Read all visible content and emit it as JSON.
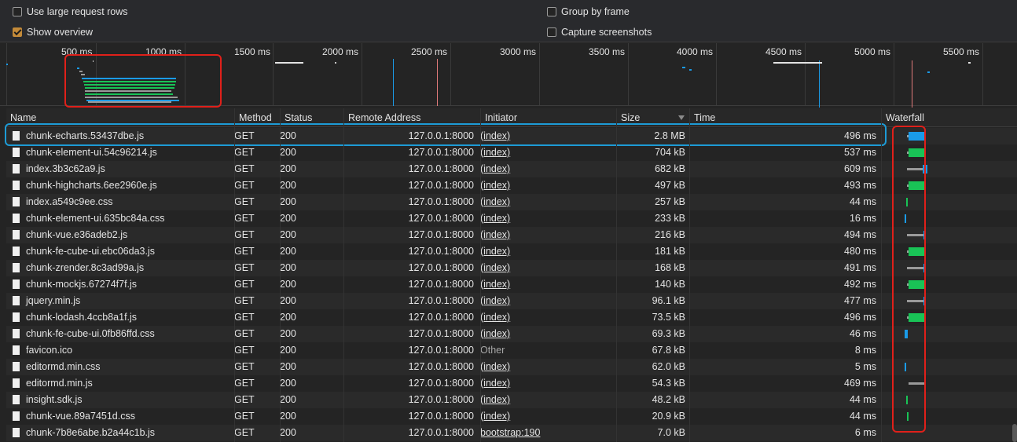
{
  "settings": {
    "large_rows": "Use large request rows",
    "show_overview": "Show overview",
    "group_by_frame": "Group by frame",
    "capture_screenshots": "Capture screenshots"
  },
  "overview": {
    "ticks": [
      "500 ms",
      "1000 ms",
      "1500 ms",
      "2000 ms",
      "2500 ms",
      "3000 ms",
      "3500 ms",
      "4000 ms",
      "4500 ms",
      "5000 ms",
      "5500 ms"
    ]
  },
  "columns": {
    "name": "Name",
    "method": "Method",
    "status": "Status",
    "remote": "Remote Address",
    "initiator": "Initiator",
    "size": "Size",
    "time": "Time",
    "waterfall": "Waterfall"
  },
  "colors": {
    "blue": "#1a9be8",
    "green": "#19c356",
    "gray": "#9a9a9a",
    "highlight_red": "#e0201a",
    "highlight_blue": "#1d9bd6"
  },
  "rows": [
    {
      "name": "chunk-echarts.53437dbe.js",
      "method": "GET",
      "status": "200",
      "remote": "127.0.0.1:8000",
      "initiator": "(index)",
      "size": "2.8 MB",
      "time": "496 ms"
    },
    {
      "name": "chunk-element-ui.54c96214.js",
      "method": "GET",
      "status": "200",
      "remote": "127.0.0.1:8000",
      "initiator": "(index)",
      "size": "704 kB",
      "time": "537 ms"
    },
    {
      "name": "index.3b3c62a9.js",
      "method": "GET",
      "status": "200",
      "remote": "127.0.0.1:8000",
      "initiator": "(index)",
      "size": "682 kB",
      "time": "609 ms"
    },
    {
      "name": "chunk-highcharts.6ee2960e.js",
      "method": "GET",
      "status": "200",
      "remote": "127.0.0.1:8000",
      "initiator": "(index)",
      "size": "497 kB",
      "time": "493 ms"
    },
    {
      "name": "index.a549c9ee.css",
      "method": "GET",
      "status": "200",
      "remote": "127.0.0.1:8000",
      "initiator": "(index)",
      "size": "257 kB",
      "time": "44 ms"
    },
    {
      "name": "chunk-element-ui.635bc84a.css",
      "method": "GET",
      "status": "200",
      "remote": "127.0.0.1:8000",
      "initiator": "(index)",
      "size": "233 kB",
      "time": "16 ms"
    },
    {
      "name": "chunk-vue.e36adeb2.js",
      "method": "GET",
      "status": "200",
      "remote": "127.0.0.1:8000",
      "initiator": "(index)",
      "size": "216 kB",
      "time": "494 ms"
    },
    {
      "name": "chunk-fe-cube-ui.ebc06da3.js",
      "method": "GET",
      "status": "200",
      "remote": "127.0.0.1:8000",
      "initiator": "(index)",
      "size": "181 kB",
      "time": "480 ms"
    },
    {
      "name": "chunk-zrender.8c3ad99a.js",
      "method": "GET",
      "status": "200",
      "remote": "127.0.0.1:8000",
      "initiator": "(index)",
      "size": "168 kB",
      "time": "491 ms"
    },
    {
      "name": "chunk-mockjs.67274f7f.js",
      "method": "GET",
      "status": "200",
      "remote": "127.0.0.1:8000",
      "initiator": "(index)",
      "size": "140 kB",
      "time": "492 ms"
    },
    {
      "name": "jquery.min.js",
      "method": "GET",
      "status": "200",
      "remote": "127.0.0.1:8000",
      "initiator": "(index)",
      "size": "96.1 kB",
      "time": "477 ms"
    },
    {
      "name": "chunk-lodash.4ccb8a1f.js",
      "method": "GET",
      "status": "200",
      "remote": "127.0.0.1:8000",
      "initiator": "(index)",
      "size": "73.5 kB",
      "time": "496 ms"
    },
    {
      "name": "chunk-fe-cube-ui.0fb86ffd.css",
      "method": "GET",
      "status": "200",
      "remote": "127.0.0.1:8000",
      "initiator": "(index)",
      "size": "69.3 kB",
      "time": "46 ms"
    },
    {
      "name": "favicon.ico",
      "method": "GET",
      "status": "200",
      "remote": "127.0.0.1:8000",
      "initiator": "Other",
      "size": "67.8 kB",
      "time": "8 ms"
    },
    {
      "name": "editormd.min.css",
      "method": "GET",
      "status": "200",
      "remote": "127.0.0.1:8000",
      "initiator": "(index)",
      "size": "62.0 kB",
      "time": "5 ms"
    },
    {
      "name": "editormd.min.js",
      "method": "GET",
      "status": "200",
      "remote": "127.0.0.1:8000",
      "initiator": "(index)",
      "size": "54.3 kB",
      "time": "469 ms"
    },
    {
      "name": "insight.sdk.js",
      "method": "GET",
      "status": "200",
      "remote": "127.0.0.1:8000",
      "initiator": "(index)",
      "size": "48.2 kB",
      "time": "44 ms"
    },
    {
      "name": "chunk-vue.89a7451d.css",
      "method": "GET",
      "status": "200",
      "remote": "127.0.0.1:8000",
      "initiator": "(index)",
      "size": "20.9 kB",
      "time": "44 ms"
    },
    {
      "name": "chunk-7b8e6abe.b2a44c1b.js",
      "method": "GET",
      "status": "200",
      "remote": "127.0.0.1:8000",
      "initiator": "bootstrap:190",
      "size": "7.0 kB",
      "time": "6 ms"
    }
  ]
}
